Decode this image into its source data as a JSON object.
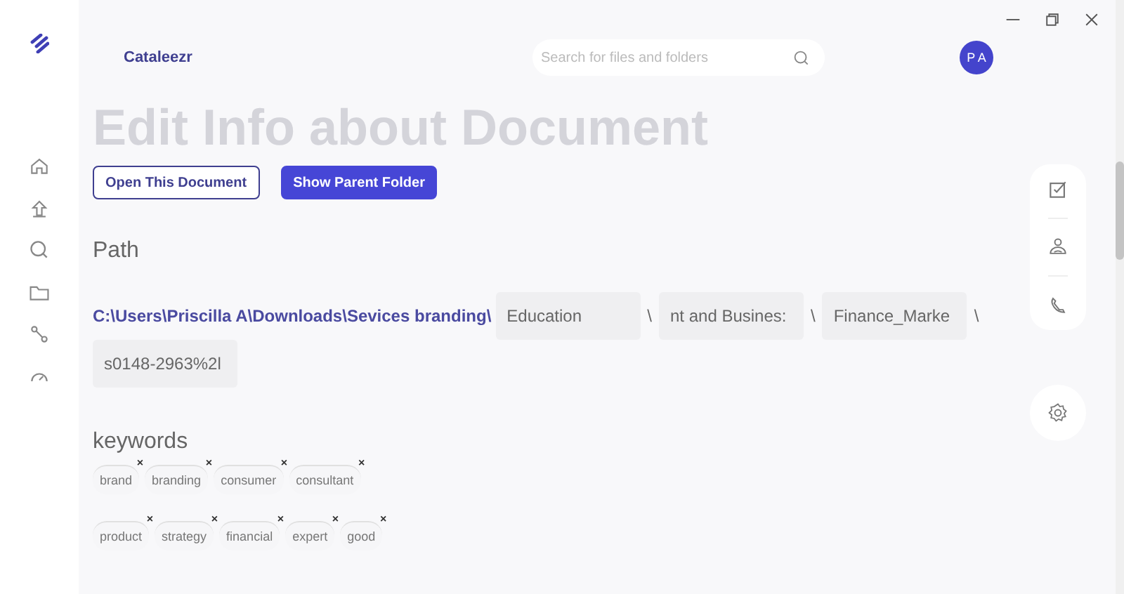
{
  "header": {
    "app_name": "Cataleezr",
    "search": {
      "placeholder": "Search for files and folders"
    },
    "avatar": "P A"
  },
  "title": "Edit Info about Document",
  "buttons": [
    {
      "label": "Open This Document",
      "kind": "outline"
    },
    {
      "label": "Show Parent Folder",
      "kind": "filled"
    }
  ],
  "path": {
    "heading": "Path",
    "prefix": "C:\\Users\\Priscilla A\\Downloads\\Sevices branding\\",
    "segments": [
      "Education",
      "nt and Busines:",
      "Finance_Marke",
      "s0148-2963%2l"
    ],
    "separators": [
      "\\",
      "\\",
      "\\"
    ]
  },
  "keywords": {
    "heading": "keywords",
    "items": [
      {
        "label": "brand",
        "remove": "×"
      },
      {
        "label": "branding",
        "remove": "×"
      },
      {
        "label": "consumer",
        "remove": "×"
      },
      {
        "label": "consultant",
        "remove": "×"
      },
      {
        "label": "product",
        "remove": "×"
      },
      {
        "label": "strategy",
        "remove": "×"
      },
      {
        "label": "financial",
        "remove": "×"
      },
      {
        "label": "expert",
        "remove": "×"
      },
      {
        "label": "good",
        "remove": "×"
      }
    ]
  }
}
